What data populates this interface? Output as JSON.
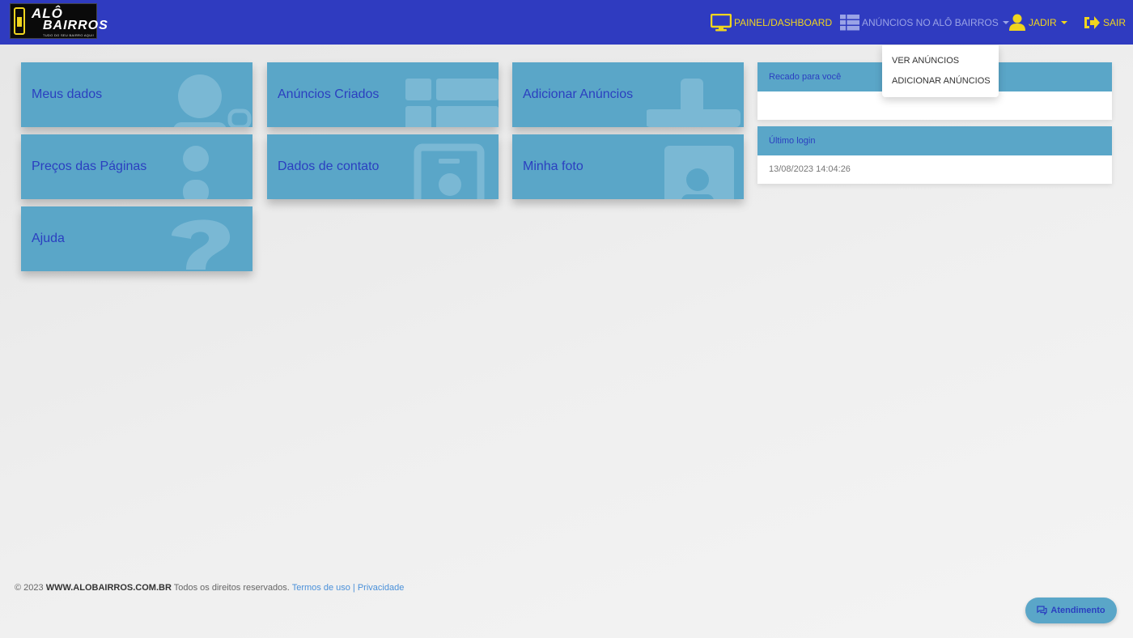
{
  "brand": {
    "line1": "ALÔ",
    "line2": "BAIRROS",
    "tagline": "TUDO DO SEU BAIRRO AQUI!"
  },
  "nav": {
    "dashboard": "PAINEL/DASHBOARD",
    "ads": "ANÚNCIOS NO ALÔ BAIRROS",
    "user": "JADIR",
    "logout": "SAIR"
  },
  "dropdown": {
    "items": [
      "VER ANÚNCIOS",
      "ADICIONAR ANÚNCIOS"
    ]
  },
  "tiles": [
    {
      "label": "Meus dados",
      "icon": "user-icon"
    },
    {
      "label": "Anúncios Criados",
      "icon": "list-icon"
    },
    {
      "label": "Adicionar Anúncios",
      "icon": "plus-icon"
    },
    {
      "label": "Preços das Páginas",
      "icon": "info-icon"
    },
    {
      "label": "Dados de contato",
      "icon": "contact-card-icon"
    },
    {
      "label": "Minha foto",
      "icon": "photo-icon"
    },
    {
      "label": "Ajuda",
      "icon": "question-icon"
    }
  ],
  "panels": {
    "message": {
      "title": "Recado para você",
      "body": ""
    },
    "last_login": {
      "title": "Último login",
      "body": "13/08/2023 14:04:26"
    }
  },
  "footer": {
    "copy": "© 2023",
    "site": "WWW.ALOBAIRROS.COM.BR",
    "rights": "Todos os direitos reservados.",
    "terms": "Termos de uso",
    "sep": "|",
    "privacy": "Privacidade"
  },
  "support_button": "Atendimento",
  "colors": {
    "navbar": "#2f3bc0",
    "accent_yellow": "#f0d51e",
    "tile": "#5aa6c8",
    "tile_text": "#2b3fc0"
  }
}
